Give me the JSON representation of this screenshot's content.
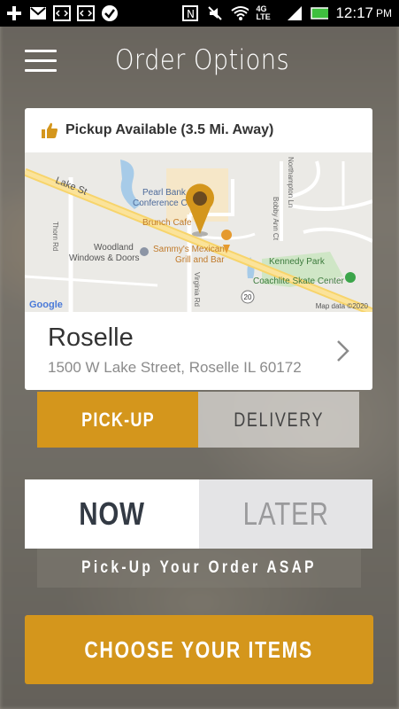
{
  "status_bar": {
    "time": "12:17",
    "ampm": "PM",
    "network": "4G LTE",
    "icons": [
      "add-icon",
      "gmail-icon",
      "code-icon",
      "code-icon",
      "check-icon",
      "nfc-icon",
      "mute-icon",
      "wifi-icon",
      "signal-icon",
      "battery-icon"
    ]
  },
  "header": {
    "title": "Order Options",
    "menu_icon": "hamburger-menu-icon"
  },
  "store_card": {
    "pickup_label": "Pickup Available (3.5 Mi. Away)",
    "store_name": "Roselle",
    "address": "1500 W Lake Street, Roselle IL 60172",
    "map": {
      "labels": {
        "lake_st": "Lake St",
        "pearl_bank": "Pearl Bank",
        "conference": "Conference C",
        "brunch_cafe": "Brunch Cafe",
        "sammys1": "Sammy's Mexican",
        "sammys2": "Grill and Bar",
        "woodland1": "Woodland",
        "woodland2": "Windows & Doors",
        "kennedy_park": "Kennedy Park",
        "skate_center": "Coachlite Skate Center",
        "thorn_rd": "Thorn Rd",
        "virginia_rd": "Virginia Rd",
        "bobby_ann_ct": "Bobby Ann Ct",
        "northampton": "Northampton Ln",
        "route": "20",
        "google": "Google",
        "map_data": "Map data ©2020"
      },
      "pin_color": "#d4961c"
    }
  },
  "fulfillment_toggle": {
    "pickup": "PICK-UP",
    "delivery": "DELIVERY",
    "selected": "PICK-UP"
  },
  "time_toggle": {
    "now": "NOW",
    "later": "LATER",
    "selected": "NOW"
  },
  "asap_text": "Pick-Up Your Order ASAP",
  "cta": {
    "label": "CHOOSE YOUR ITEMS"
  },
  "colors": {
    "accent": "#d4961c"
  }
}
